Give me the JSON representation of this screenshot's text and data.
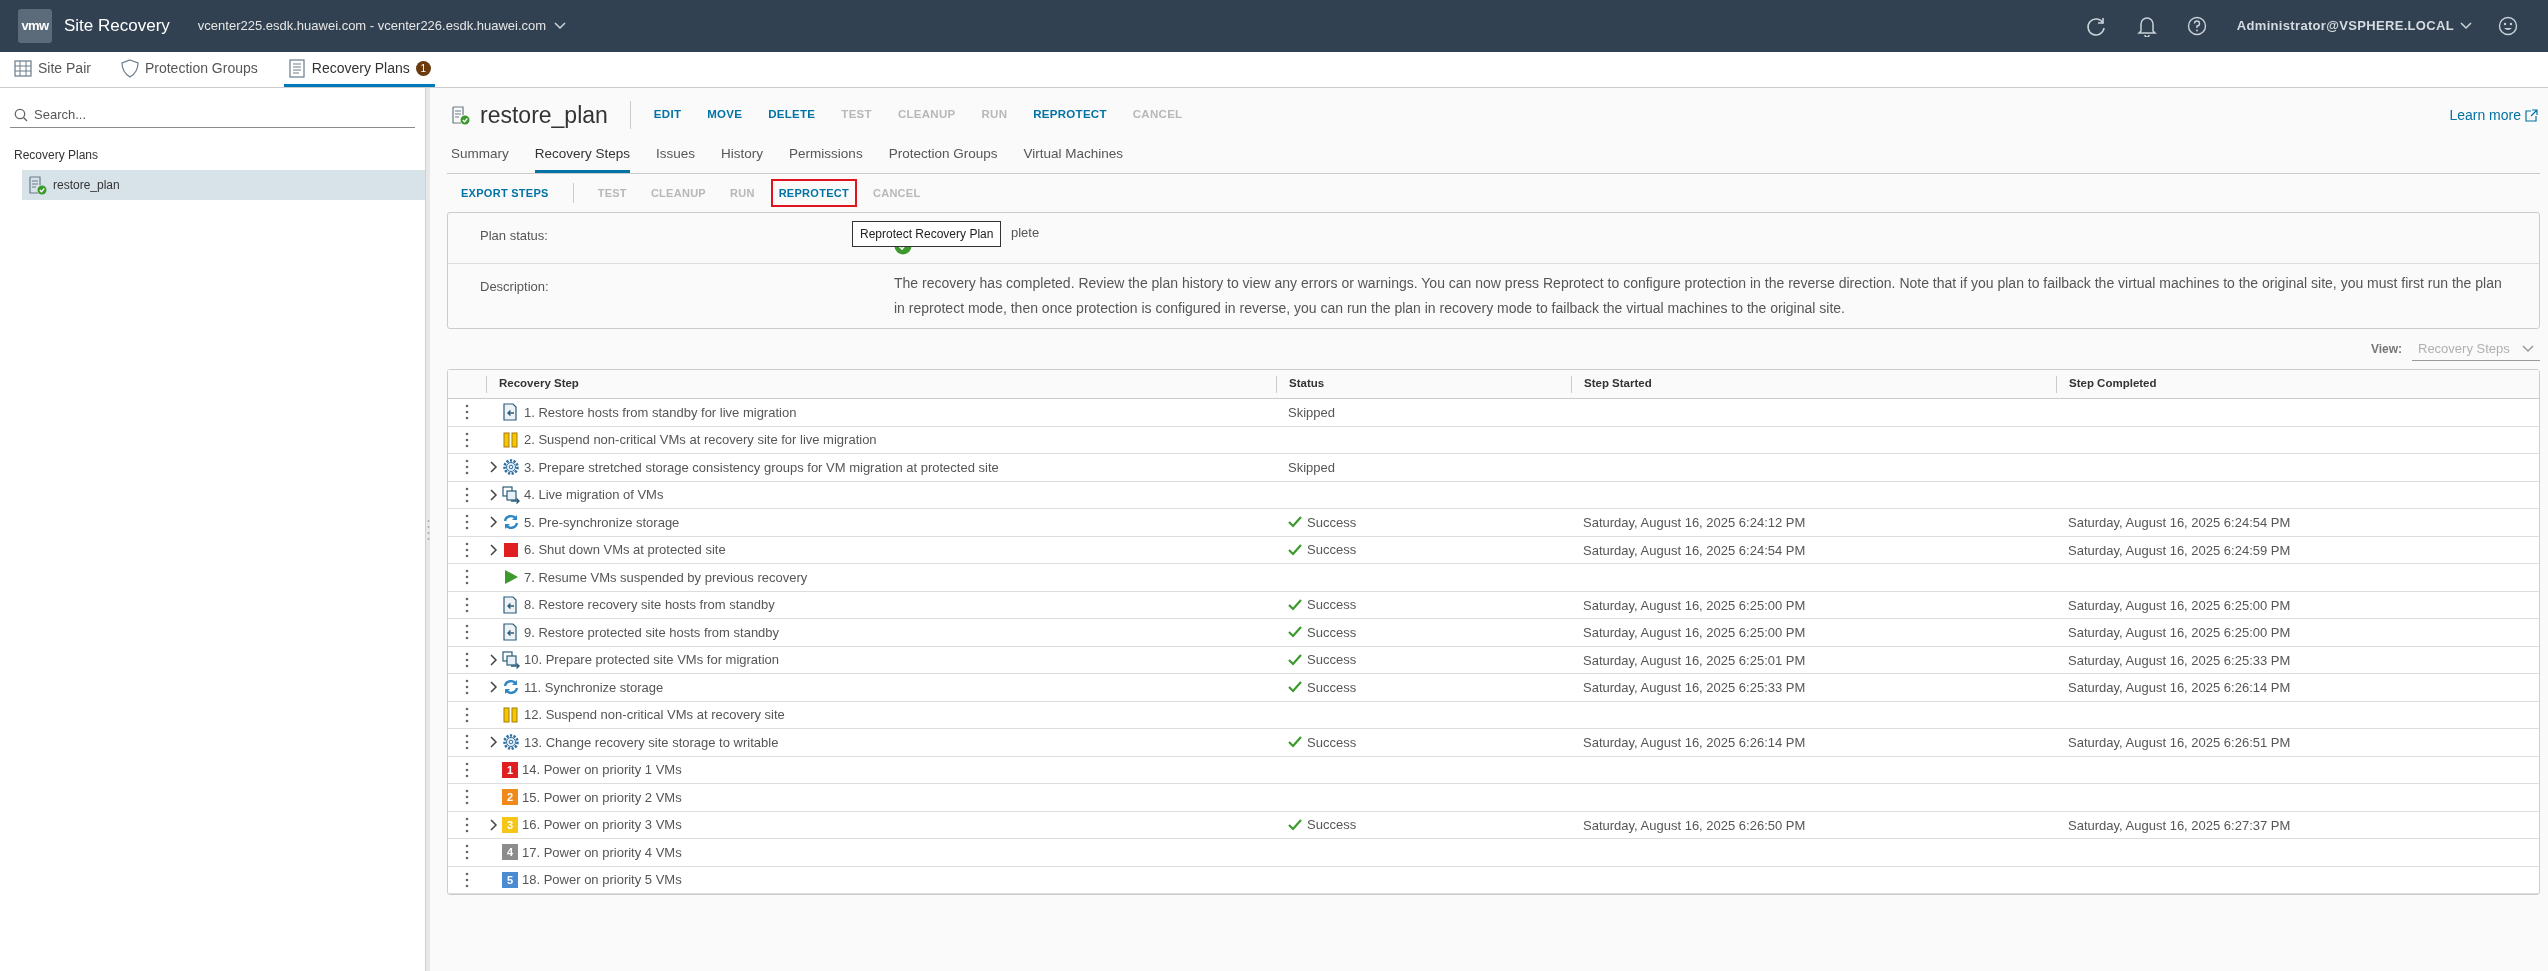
{
  "header": {
    "logo": "vmw",
    "app_title": "Site Recovery",
    "site_pair": "vcenter225.esdk.huawei.com - vcenter226.esdk.huawei.com",
    "user": "Administrator@VSPHERE.LOCAL"
  },
  "nav_tabs": [
    {
      "label": "Site Pair",
      "selected": false
    },
    {
      "label": "Protection Groups",
      "selected": false
    },
    {
      "label": "Recovery Plans",
      "selected": true,
      "badge": "1"
    }
  ],
  "sidebar": {
    "search_placeholder": "Search...",
    "section": "Recovery Plans",
    "items": [
      {
        "label": "restore_plan",
        "selected": true
      }
    ]
  },
  "plan": {
    "title": "restore_plan",
    "learn_more": "Learn more",
    "actions": [
      {
        "label": "EDIT",
        "disabled": false
      },
      {
        "label": "MOVE",
        "disabled": false
      },
      {
        "label": "DELETE",
        "disabled": false
      },
      {
        "label": "TEST",
        "disabled": true
      },
      {
        "label": "CLEANUP",
        "disabled": true
      },
      {
        "label": "RUN",
        "disabled": true
      },
      {
        "label": "REPROTECT",
        "disabled": false
      },
      {
        "label": "CANCEL",
        "disabled": true
      }
    ]
  },
  "sub_tabs": [
    {
      "label": "Summary",
      "selected": false
    },
    {
      "label": "Recovery Steps",
      "selected": true
    },
    {
      "label": "Issues",
      "selected": false
    },
    {
      "label": "History",
      "selected": false
    },
    {
      "label": "Permissions",
      "selected": false
    },
    {
      "label": "Protection Groups",
      "selected": false
    },
    {
      "label": "Virtual Machines",
      "selected": false
    }
  ],
  "toolbar": [
    {
      "label": "EXPORT STEPS",
      "disabled": false,
      "highlighted": false
    },
    {
      "label": "TEST",
      "disabled": true,
      "highlighted": false
    },
    {
      "label": "CLEANUP",
      "disabled": true,
      "highlighted": false
    },
    {
      "label": "RUN",
      "disabled": true,
      "highlighted": false
    },
    {
      "label": "REPROTECT",
      "disabled": false,
      "highlighted": true
    },
    {
      "label": "CANCEL",
      "disabled": true,
      "highlighted": false
    }
  ],
  "tooltip": "Reprotect Recovery Plan",
  "info": {
    "plan_status_label": "Plan status:",
    "plan_status_value": "plete",
    "description_label": "Description:",
    "description": "The recovery has completed. Review the plan history to view any errors or warnings. You can now press Reprotect to configure protection in the reverse direction. Note that if you plan to failback the virtual machines to the original site, you must first run the plan in reprotect mode, then once protection is configured in reverse, you can run the plan in recovery mode to failback the virtual machines to the original site."
  },
  "view": {
    "label": "View:",
    "value": "Recovery Steps"
  },
  "table": {
    "columns": [
      "Recovery Step",
      "Status",
      "Step Started",
      "Step Completed"
    ],
    "rows": [
      {
        "step": "1. Restore hosts from standby for live migration",
        "expandable": false,
        "kind": "host",
        "status": "Skipped",
        "succeeded": false
      },
      {
        "step": "2. Suspend non-critical VMs at recovery site for live migration",
        "expandable": false,
        "kind": "pause"
      },
      {
        "step": "3. Prepare stretched storage consistency groups for VM migration at protected site",
        "expandable": true,
        "kind": "gear",
        "status": "Skipped",
        "succeeded": false
      },
      {
        "step": "4. Live migration of VMs",
        "expandable": true,
        "kind": "migrate"
      },
      {
        "step": "5. Pre-synchronize storage",
        "expandable": true,
        "kind": "sync",
        "status": "Success",
        "succeeded": true,
        "started": "Saturday, August 16, 2025 6:24:12 PM",
        "completed": "Saturday, August 16, 2025 6:24:54 PM"
      },
      {
        "step": "6. Shut down VMs at protected site",
        "expandable": true,
        "kind": "stop",
        "status": "Success",
        "succeeded": true,
        "started": "Saturday, August 16, 2025 6:24:54 PM",
        "completed": "Saturday, August 16, 2025 6:24:59 PM"
      },
      {
        "step": "7. Resume VMs suspended by previous recovery",
        "expandable": false,
        "kind": "play"
      },
      {
        "step": "8. Restore recovery site hosts from standby",
        "expandable": false,
        "kind": "host",
        "status": "Success",
        "succeeded": true,
        "started": "Saturday, August 16, 2025 6:25:00 PM",
        "completed": "Saturday, August 16, 2025 6:25:00 PM"
      },
      {
        "step": "9. Restore protected site hosts from standby",
        "expandable": false,
        "kind": "host",
        "status": "Success",
        "succeeded": true,
        "started": "Saturday, August 16, 2025 6:25:00 PM",
        "completed": "Saturday, August 16, 2025 6:25:00 PM"
      },
      {
        "step": "10. Prepare protected site VMs for migration",
        "expandable": true,
        "kind": "migrate",
        "status": "Success",
        "succeeded": true,
        "started": "Saturday, August 16, 2025 6:25:01 PM",
        "completed": "Saturday, August 16, 2025 6:25:33 PM"
      },
      {
        "step": "11. Synchronize storage",
        "expandable": true,
        "kind": "sync",
        "status": "Success",
        "succeeded": true,
        "started": "Saturday, August 16, 2025 6:25:33 PM",
        "completed": "Saturday, August 16, 2025 6:26:14 PM"
      },
      {
        "step": "12. Suspend non-critical VMs at recovery site",
        "expandable": false,
        "kind": "pause"
      },
      {
        "step": "13. Change recovery site storage to writable",
        "expandable": true,
        "kind": "gear",
        "status": "Success",
        "succeeded": true,
        "started": "Saturday, August 16, 2025 6:26:14 PM",
        "completed": "Saturday, August 16, 2025 6:26:51 PM"
      },
      {
        "step": "14. Power on priority 1 VMs",
        "expandable": false,
        "kind": "priority",
        "badge": "1",
        "color": "#e02020"
      },
      {
        "step": "15. Power on priority 2 VMs",
        "expandable": false,
        "kind": "priority",
        "badge": "2",
        "color": "#f08a1c"
      },
      {
        "step": "16. Power on priority 3 VMs",
        "expandable": true,
        "kind": "priority",
        "badge": "3",
        "color": "#f5c518",
        "status": "Success",
        "succeeded": true,
        "started": "Saturday, August 16, 2025 6:26:50 PM",
        "completed": "Saturday, August 16, 2025 6:27:37 PM"
      },
      {
        "step": "17. Power on priority 4 VMs",
        "expandable": false,
        "kind": "priority",
        "badge": "4",
        "color": "#8c8c8c"
      },
      {
        "step": "18. Power on priority 5 VMs",
        "expandable": false,
        "kind": "priority",
        "badge": "5",
        "color": "#4a8bd1"
      }
    ]
  }
}
